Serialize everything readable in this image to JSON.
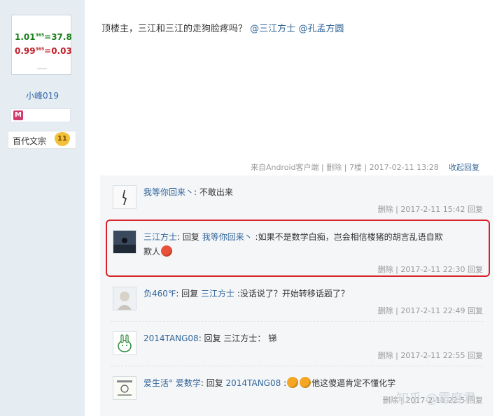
{
  "sidebar": {
    "avatar": {
      "line1_base": "1.01",
      "line1_exp": "365",
      "line1_result": "=37.8",
      "line2_base": "0.99",
      "line2_exp": "365",
      "line2_result": "=0.03"
    },
    "username": "小峰019",
    "medal_icon": "M",
    "rank_label": "百代文宗",
    "rank_badge": "11"
  },
  "post": {
    "text": "顶楼主，三江和三江的走狗脸疼吗？",
    "mention1": "@三江方士",
    "mention2": "@孔孟方圆",
    "meta_source": "来自Android客户端",
    "meta_delete": "删除",
    "meta_floor": "7楼",
    "meta_time": "2017-02-11 13:28",
    "collapse_label": "收起回复"
  },
  "replies": [
    {
      "avatar_icon": "sketch-icon",
      "name": "我等你回来丶",
      "reply_word": "",
      "target": "",
      "text": ": 不敢出来",
      "delete": "删除",
      "time": "2017-2-11 15:42",
      "reply_label": "回复"
    },
    {
      "avatar_icon": "landscape-icon",
      "name": "三江方士",
      "reply_word": ": 回复",
      "target": "我等你回来丶",
      "text": ":如果不是数学白痴，岂会相信楼猪的胡言乱语自欺",
      "text2": "欺人",
      "delete": "删除",
      "time": "2017-2-11 22:30",
      "reply_label": "回复"
    },
    {
      "avatar_icon": "anime-girl-icon",
      "name": "负460℉",
      "reply_word": ": 回复",
      "target": "三江方士",
      "text": ":没话说了？开始转移话题了？",
      "delete": "删除",
      "time": "2017-2-11 22:49",
      "reply_label": "回复"
    },
    {
      "avatar_icon": "rabbit-icon",
      "name": "2014TANG08",
      "reply_word": ": 回复",
      "target": "三江方士",
      "text": "： 锑",
      "delete": "删除",
      "time": "2017-2-11 22:55",
      "reply_label": "回复"
    },
    {
      "avatar_icon": "cartoon-icon",
      "name": "爱生活°",
      "name2": "爱数学",
      "reply_word": ": 回复",
      "target": "2014TANG08",
      "text": "他这傻逼肯定不懂化学",
      "delete": "删除",
      "time": "2017-2-11 22:5",
      "reply_label": "回复"
    }
  ],
  "watermark": "知乎 @霉度君",
  "colors": {
    "sidebar_bg": "#e5edf2",
    "link": "#336699",
    "highlight": "#d8232a",
    "reply_bg": "#f4f6f8"
  }
}
